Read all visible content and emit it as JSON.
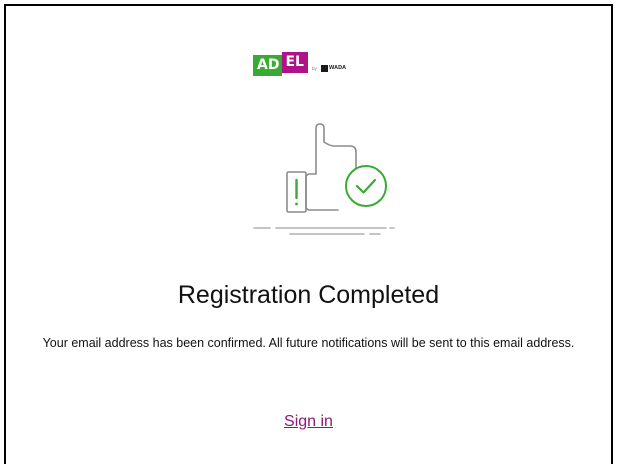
{
  "brand": {
    "logo_ad": "AD",
    "logo_el": "EL",
    "logo_by": "by",
    "logo_org": "WADA",
    "color_green": "#3aaa35",
    "color_magenta": "#b0128a"
  },
  "illustration": {
    "icon": "thumbs-up-with-check-icon",
    "stroke_color": "#8c8c8c",
    "accent_color": "#3aaa35"
  },
  "content": {
    "title": "Registration Completed",
    "message": "Your email address has been confirmed. All future notifications will be sent to this email address."
  },
  "actions": {
    "sign_in_label": "Sign in",
    "link_color": "#8a1a7a"
  }
}
